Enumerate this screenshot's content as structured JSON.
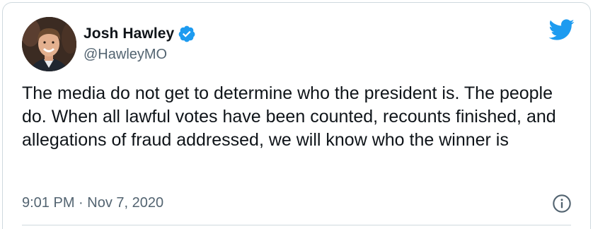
{
  "tweet": {
    "display_name": "Josh Hawley",
    "handle": "@HawleyMO",
    "verified_icon": "verified-badge-icon",
    "brand_icon": "twitter-bird-icon",
    "text": "The media do not get to determine who the president is. The people do. When all lawful votes have been counted, recounts finished, and allegations of fraud addressed, we will know who the winner is",
    "time": "9:01 PM",
    "separator": "·",
    "date": "Nov 7, 2020",
    "info_icon": "info-icon"
  },
  "colors": {
    "brand_blue": "#1d9bf0",
    "text_primary": "#0f1419",
    "text_secondary": "#536471",
    "border": "#cfd9de"
  }
}
